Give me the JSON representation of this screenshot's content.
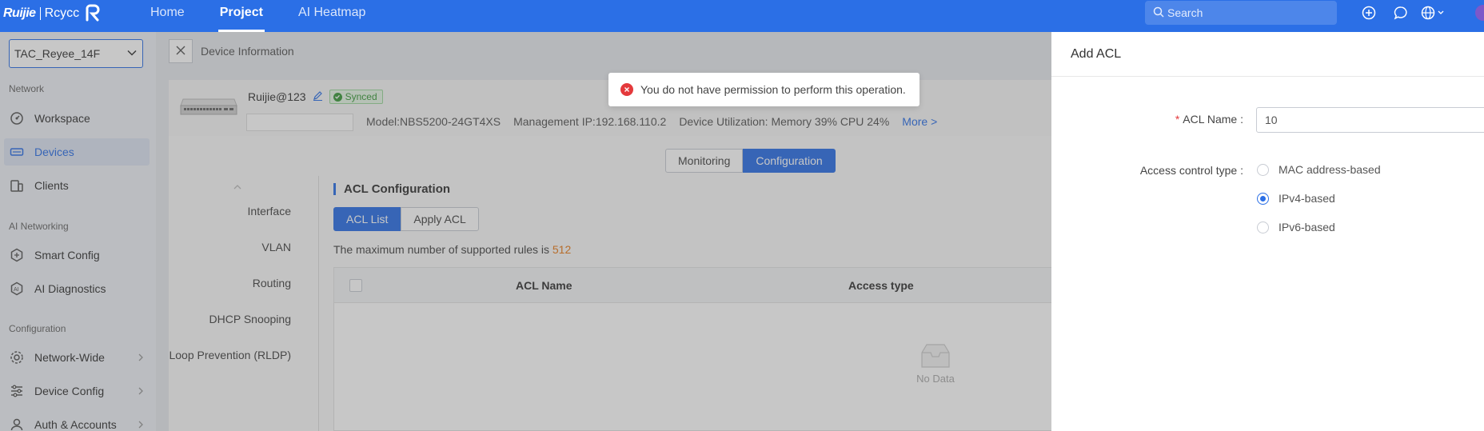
{
  "brand": {
    "ruijie": "Ruijie",
    "rcycc": "Rcycc"
  },
  "topnav": {
    "items": [
      {
        "label": "Home"
      },
      {
        "label": "Project"
      },
      {
        "label": "AI Heatmap"
      }
    ]
  },
  "search": {
    "placeholder": "Search"
  },
  "sidebar": {
    "site": "TAC_Reyee_14F",
    "sections": {
      "network": "Network",
      "ai_networking": "AI Networking",
      "configuration": "Configuration"
    },
    "items": [
      {
        "label": "Workspace"
      },
      {
        "label": "Devices"
      },
      {
        "label": "Clients"
      },
      {
        "label": "Smart Config"
      },
      {
        "label": "AI Diagnostics"
      },
      {
        "label": "Network-Wide"
      },
      {
        "label": "Device Config"
      },
      {
        "label": "Auth & Accounts"
      }
    ]
  },
  "breadcrumb": {
    "title": "Device Information"
  },
  "device": {
    "name": "Ruijie@123",
    "status": "Synced",
    "model": "Model:NBS5200-24GT4XS",
    "mgmt_ip": "Management IP:192.168.110.2",
    "utilization": "Device Utilization: Memory 39% CPU 24%",
    "more": "More >"
  },
  "mode_tabs": {
    "monitoring": "Monitoring",
    "configuration": "Configuration"
  },
  "subnav": {
    "items": [
      "Interface",
      "VLAN",
      "Routing",
      "DHCP Snooping",
      "Loop Prevention (RLDP)"
    ]
  },
  "acl": {
    "section_title": "ACL Configuration",
    "tabs": {
      "list": "ACL List",
      "apply": "Apply ACL"
    },
    "rules_prefix": "The maximum number of supported rules is ",
    "rules_max": "512",
    "columns": {
      "name": "ACL Name",
      "access_type": "Access type"
    },
    "empty": "No Data"
  },
  "toast": {
    "message": "You do not have permission to perform this operation."
  },
  "drawer": {
    "title": "Add ACL",
    "acl_name_label": "ACL Name",
    "acl_name_value": "10",
    "access_type_label": "Access control type",
    "options": [
      "MAC address-based",
      "IPv4-based",
      "IPv6-based"
    ],
    "selected_option": "IPv4-based"
  },
  "colors": {
    "primary": "#2b6fe6",
    "error": "#e4393c",
    "success": "#3a9a3a",
    "highlight": "#e77b1a"
  }
}
